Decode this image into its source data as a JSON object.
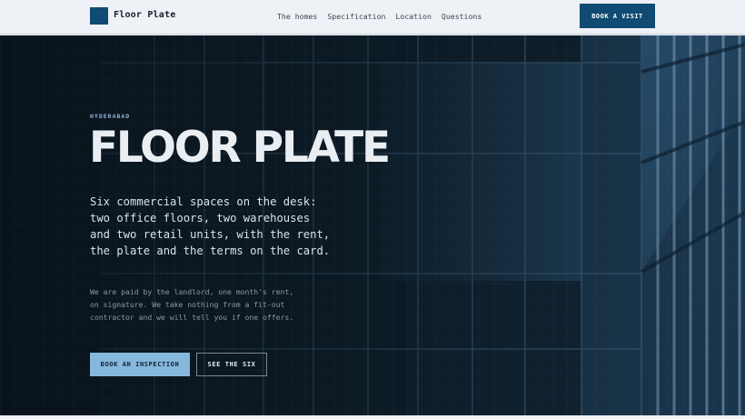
{
  "header": {
    "brand": "Floor Plate",
    "nav": [
      "The homes",
      "Specification",
      "Location",
      "Questions"
    ],
    "cta": "BOOK A VISIT"
  },
  "hero": {
    "eyebrow": "HYDERABAD",
    "title": "FLOOR PLATE",
    "lead": "Six commercial spaces on the desk: two office floors, two warehouses and two retail units, with the rent, the plate and the terms on the card.",
    "note": "We are paid by the landlord, one month's rent, on signature. We take nothing from a fit-out contractor and we will tell you if one offers.",
    "primary_button": "BOOK AN INSPECTION",
    "secondary_button": "SEE THE SIX"
  },
  "colors": {
    "brand": "#0f4b72",
    "accent": "#86b8dc",
    "hero_dark": "#0b1721"
  }
}
